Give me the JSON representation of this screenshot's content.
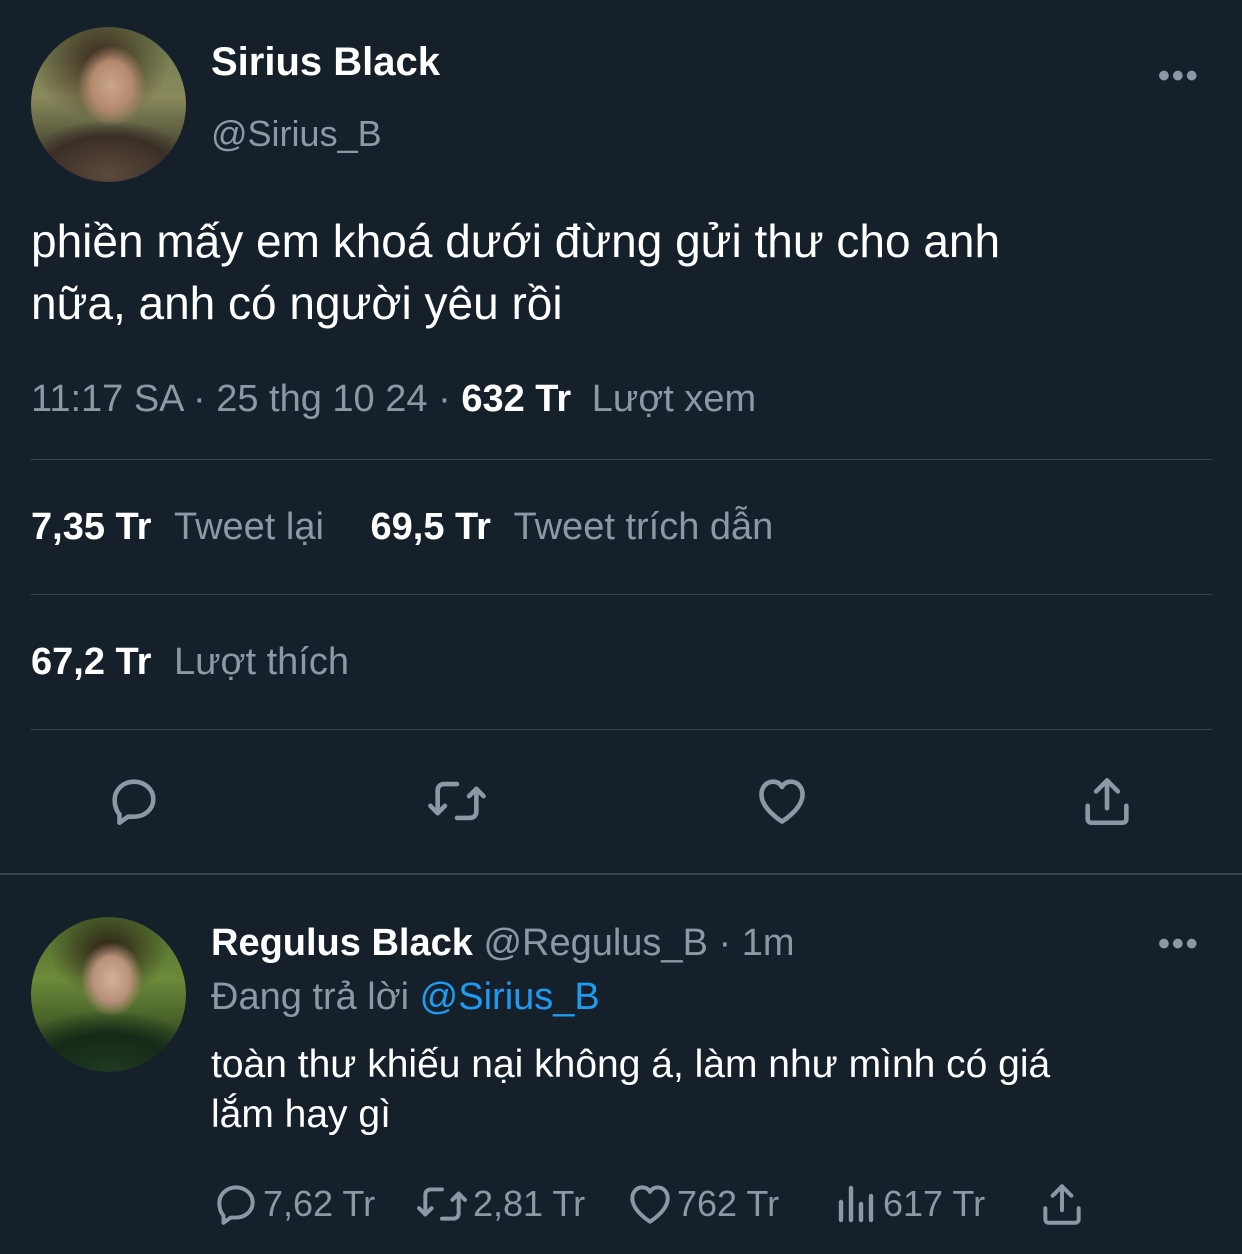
{
  "tweet": {
    "author_name": "Sirius Black",
    "author_handle": "@Sirius_B",
    "text_line1": "phiền mấy em khoá dưới đừng gửi thư cho anh",
    "text_line2": "nữa, anh có người yêu rồi",
    "time": "11:17 SA",
    "date": "25 thg 10 24",
    "views_count": "632 Tr",
    "views_label": "Lượt xem",
    "retweets_count": "7,35 Tr",
    "retweets_label": "Tweet lại",
    "quotes_count": "69,5 Tr",
    "quotes_label": "Tweet trích dẫn",
    "likes_count": "67,2 Tr",
    "likes_label": "Lượt thích"
  },
  "reply": {
    "author_name": "Regulus Black",
    "author_handle": "@Regulus_B",
    "time_ago": "1m",
    "replying_prefix": "Đang trả lời",
    "replying_to": "@Sirius_B",
    "text_line1": "toàn thư khiếu nại không á, làm như mình có giá",
    "text_line2": "lắm hay gì",
    "reply_count": "7,62 Tr",
    "retweet_count": "2,81 Tr",
    "like_count": "762 Tr",
    "view_count": "617 Tr"
  },
  "icons": {
    "more": "more-icon",
    "reply": "reply-icon",
    "retweet": "retweet-icon",
    "like": "heart-icon",
    "share": "share-icon",
    "views": "analytics-icon"
  },
  "colors": {
    "background": "#15202b",
    "muted": "#8b98a5",
    "link": "#1d9bf0",
    "divider": "#38444d"
  }
}
